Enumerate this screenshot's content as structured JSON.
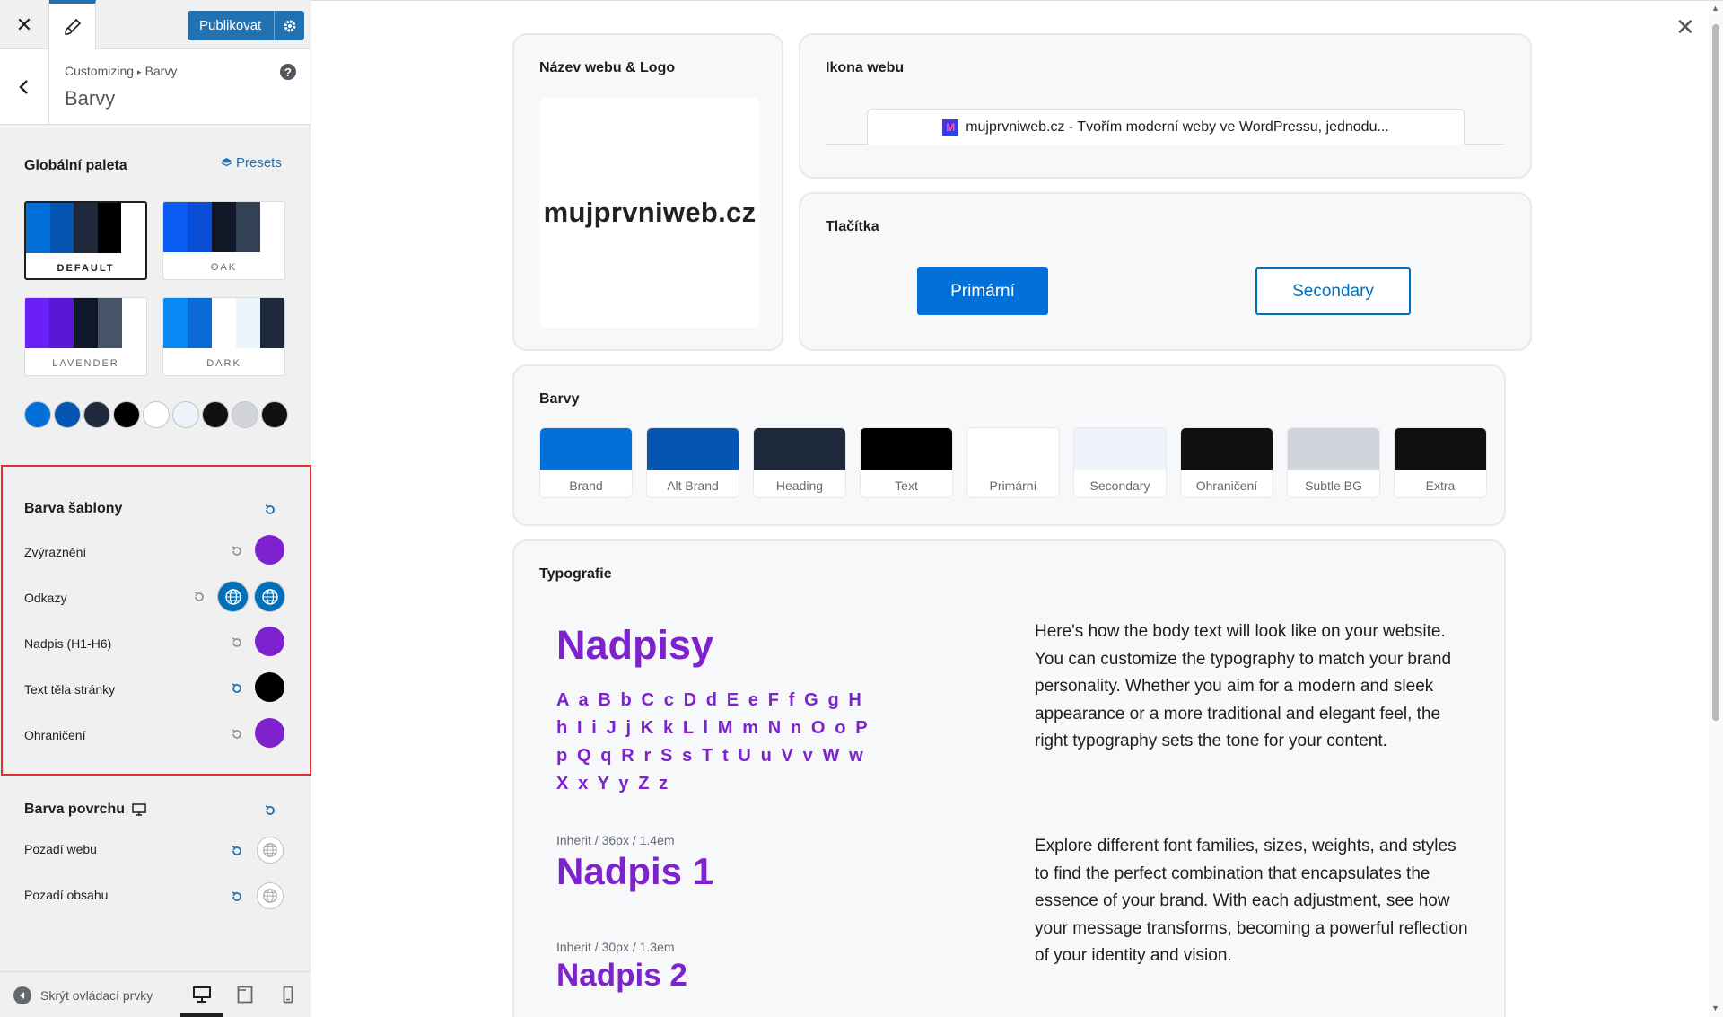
{
  "topbar": {
    "publish_label": "Publikovat"
  },
  "header": {
    "breadcrumb_root": "Customizing",
    "breadcrumb_current": "Barvy",
    "title": "Barvy"
  },
  "global_palette": {
    "title": "Globální paleta",
    "presets_label": "Presets",
    "palettes": [
      {
        "name": "DEFAULT",
        "colors": [
          "#0170d9",
          "#0456b2",
          "#1e293b",
          "#000000",
          "#ffffff"
        ]
      },
      {
        "name": "OAK",
        "colors": [
          "#0a5cf5",
          "#0a4ed8",
          "#101828",
          "#334155",
          "#ffffff"
        ]
      },
      {
        "name": "LAVENDER",
        "colors": [
          "#6b21f5",
          "#5b16d6",
          "#0f172a",
          "#475569",
          "#ffffff"
        ]
      },
      {
        "name": "DARK",
        "colors": [
          "#0a8af5",
          "#0a6ad8",
          "#ffffff",
          "#eaf4fb",
          "#1e293b"
        ]
      }
    ],
    "swatches": [
      "#0170d9",
      "#0456b2",
      "#1e293b",
      "#000000",
      "#ffffff",
      "#eef2fa",
      "#111111",
      "#d1d5db",
      "#111111"
    ]
  },
  "theme_color": {
    "title": "Barva šablony",
    "options": [
      {
        "label": "Zvýraznění",
        "color": "#7e22ce"
      },
      {
        "label": "Odkazy"
      },
      {
        "label": "Nadpis (H1-H6)",
        "color": "#7e22ce"
      },
      {
        "label": "Text těla stránky",
        "color": "#000000"
      },
      {
        "label": "Ohraničení",
        "color": "#7e22ce"
      }
    ]
  },
  "surface_color": {
    "title": "Barva povrchu",
    "options": [
      {
        "label": "Pozadí webu"
      },
      {
        "label": "Pozadí obsahu"
      }
    ]
  },
  "footer": {
    "hide_controls_label": "Skrýt ovládací prvky"
  },
  "preview": {
    "site_title_card": {
      "title": "Název webu & Logo",
      "logo_text": "mujprvniweb.cz"
    },
    "site_icon_card": {
      "title": "Ikona webu",
      "favicon_letter": "M",
      "tab_text": "mujprvniweb.cz - Tvořím moderní weby ve WordPressu, jednodu..."
    },
    "buttons_card": {
      "title": "Tlačítka",
      "primary_label": "Primární",
      "secondary_label": "Secondary"
    },
    "colors_card": {
      "title": "Barvy",
      "tiles": [
        {
          "name": "Brand",
          "color": "#0170d9"
        },
        {
          "name": "Alt Brand",
          "color": "#0456b2"
        },
        {
          "name": "Heading",
          "color": "#1e293b"
        },
        {
          "name": "Text",
          "color": "#000000"
        },
        {
          "name": "Primární",
          "color": "#ffffff"
        },
        {
          "name": "Secondary",
          "color": "#eef2fa"
        },
        {
          "name": "Ohraničení",
          "color": "#111111"
        },
        {
          "name": "Subtle BG",
          "color": "#d1d5db"
        },
        {
          "name": "Extra",
          "color": "#111111"
        }
      ]
    },
    "typography_card": {
      "title": "Typografie",
      "headings_sample": "Nadpisy",
      "alphabet": "A a B b C c D d E e F f G g H h I i J j K k L l M m N n O o P p Q q R r S s T t U u V v W w X x Y y Z z",
      "h1_meta": "Inherit / 36px / 1.4em",
      "h1_sample": "Nadpis 1",
      "h2_meta": "Inherit / 30px / 1.3em",
      "h2_sample": "Nadpis 2",
      "paragraph_1": "Here's how the body text will look like on your website. You can customize the typography to match your brand personality. Whether you aim for a modern and sleek appearance or a more traditional and elegant feel, the right typography sets the tone for your content.",
      "paragraph_2": "Explore different font families, sizes, weights, and styles to find the perfect combination that encapsulates the essence of your brand. With each adjustment, see how your message transforms, becoming a powerful reflection of your identity and vision."
    }
  },
  "colors": {
    "accent": "#2271b1",
    "purple": "#7e22ce",
    "highlight_frame": "#e0302f"
  }
}
